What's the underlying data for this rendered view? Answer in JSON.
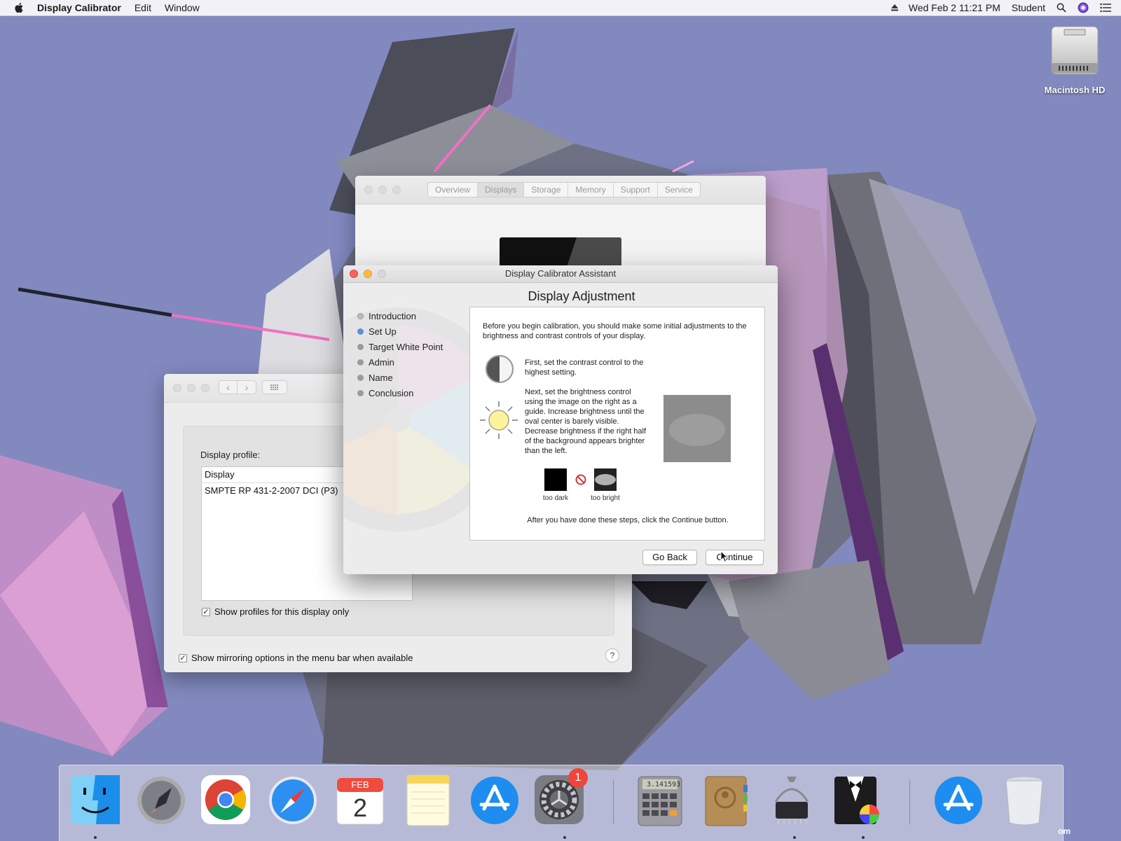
{
  "menubar": {
    "app_name": "Display Calibrator",
    "menus": [
      "Edit",
      "Window"
    ],
    "clock": "Wed Feb 2  11:21 PM",
    "user": "Student"
  },
  "desktop": {
    "hd_label": "Macintosh HD",
    "corner_text": "om"
  },
  "sysinfo": {
    "tabs": [
      "Overview",
      "Displays",
      "Storage",
      "Memory",
      "Support",
      "Service"
    ],
    "selected_tab": "Displays"
  },
  "displays_prefs": {
    "profile_label": "Display profile:",
    "list_header": "Display",
    "profiles": [
      "SMPTE RP 431-2-2007 DCI (P3)"
    ],
    "show_profiles_only": "Show profiles for this display only",
    "show_mirroring": "Show mirroring options in the menu bar when available",
    "help": "?",
    "checkmark": "✓"
  },
  "calibrator": {
    "title": "Display Calibrator Assistant",
    "heading": "Display Adjustment",
    "steps": [
      "Introduction",
      "Set Up",
      "Target White Point",
      "Admin",
      "Name",
      "Conclusion"
    ],
    "intro_text": "Before you begin calibration, you should make some initial adjustments to the brightness and contrast controls of your display.",
    "contrast_text": "First, set the contrast control to the highest setting.",
    "brightness_text": "Next, set the brightness control using the image on the right as a guide.  Increase brightness until the oval center is barely visible. Decrease brightness if the right half of the background appears brighter than the left.",
    "too_dark": "too dark",
    "too_bright": "too bright",
    "outro_text": "After you have done these steps, click the Continue button.",
    "go_back": "Go Back",
    "continue": "Continue"
  },
  "dock": {
    "calendar_month": "FEB",
    "calendar_day": "2",
    "calculator_display": "3.141593",
    "sysprefs_badge": "1"
  }
}
